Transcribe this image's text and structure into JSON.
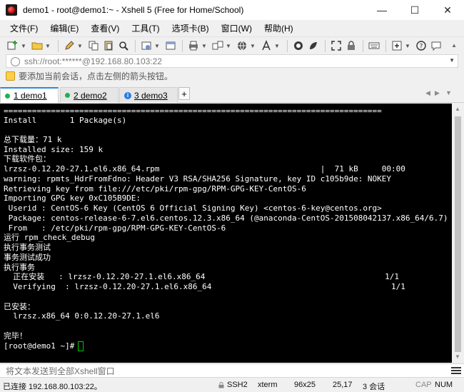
{
  "window": {
    "title": "demo1 - root@demo1:~ - Xshell 5 (Free for Home/School)",
    "controls": {
      "minimize": "—",
      "maximize": "☐",
      "close": "✕"
    }
  },
  "menu": {
    "items": [
      "文件(F)",
      "编辑(E)",
      "查看(V)",
      "工具(T)",
      "选项卡(B)",
      "窗口(W)",
      "帮助(H)"
    ]
  },
  "toolbar": {
    "icons": [
      "new-session-icon",
      "folder-icon",
      "pencil-icon",
      "copy-icon",
      "paste-icon",
      "find-icon",
      "settings-icon",
      "window-icon",
      "print-icon",
      "transfer-icon",
      "globe-icon",
      "font-icon",
      "xftp-icon",
      "xagent-icon",
      "fullscreen-icon",
      "lock-icon",
      "keyboard-icon",
      "compose-icon",
      "help-icon",
      "chat-icon"
    ]
  },
  "address": {
    "text": "ssh://root:******@192.168.80.103:22"
  },
  "hint": {
    "text": "要添加当前会话，点击左侧的箭头按钮。"
  },
  "tabs": [
    {
      "label": "1 demo1",
      "status": "connected"
    },
    {
      "label": "2 demo2",
      "status": "connected"
    },
    {
      "label": "3 demo3",
      "status": "info"
    }
  ],
  "add_tab": "+",
  "terminal": {
    "lines": [
      "================================================================================",
      "Install       1 Package(s)",
      "",
      "总下载量：71 k",
      "Installed size: 159 k",
      "下载软件包：",
      "lrzsz-0.12.20-27.1.el6.x86_64.rpm                                  |  71 kB     00:00",
      "warning: rpmts_HdrFromFdno: Header V3 RSA/SHA256 Signature, key ID c105b9de: NOKEY",
      "Retrieving key from file:///etc/pki/rpm-gpg/RPM-GPG-KEY-CentOS-6",
      "Importing GPG key 0xC105B9DE:",
      " Userid : CentOS-6 Key (CentOS 6 Official Signing Key) <centos-6-key@centos.org>",
      " Package: centos-release-6-7.el6.centos.12.3.x86_64 (@anaconda-CentOS-201508042137.x86_64/6.7)",
      " From   : /etc/pki/rpm-gpg/RPM-GPG-KEY-CentOS-6",
      "运行 rpm_check_debug",
      "执行事务测试",
      "事务测试成功",
      "执行事务",
      "  正在安装   : lrzsz-0.12.20-27.1.el6.x86_64                                      1/1",
      "  Verifying  : lrzsz-0.12.20-27.1.el6.x86_64                                      1/1",
      "",
      "已安装：",
      "  lrzsz.x86_64 0:0.12.20-27.1.el6",
      "",
      "完毕！",
      "[root@demo1 ~]# "
    ]
  },
  "sendbar": {
    "text": "将文本发送到全部Xshell窗口"
  },
  "status": {
    "connection": "已连接 192.168.80.103:22。",
    "protocol": "SSH2",
    "terminal_type": "xterm",
    "size": "96x25",
    "cursor_pos": "25,17",
    "sessions": "3 会话",
    "cap": "CAP",
    "num": "NUM"
  },
  "colors": {
    "terminal_bg": "#000000",
    "terminal_fg": "#ffffff",
    "cursor": "#00c800",
    "active_tab_accent": "#2d8ae0",
    "connected_dot": "#22b14c",
    "info_badge": "#2a7de1"
  }
}
